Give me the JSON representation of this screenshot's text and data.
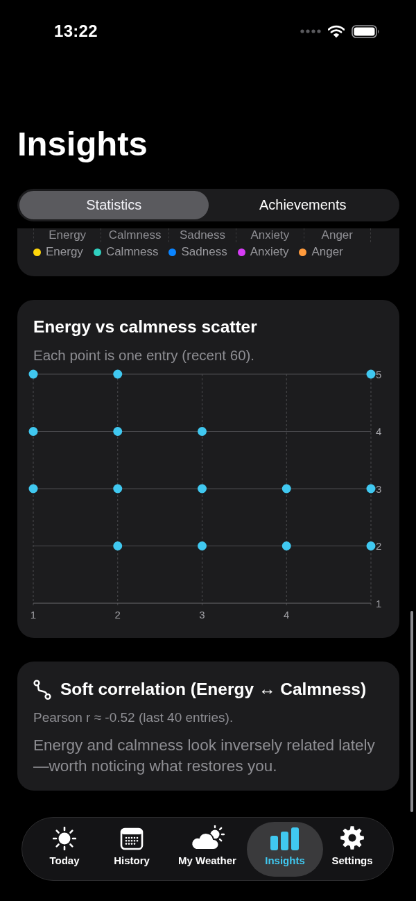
{
  "status_bar": {
    "time": "13:22"
  },
  "title": "Insights",
  "segments": [
    {
      "label": "Statistics",
      "selected": true
    },
    {
      "label": "Achievements",
      "selected": false
    }
  ],
  "emotion_card": {
    "axis_labels": [
      "Energy",
      "Calmness",
      "Sadness",
      "Anxiety",
      "Anger"
    ],
    "legend": [
      {
        "label": "Energy",
        "color": "#ffd60a"
      },
      {
        "label": "Calmness",
        "color": "#30d0c0"
      },
      {
        "label": "Sadness",
        "color": "#0a84ff"
      },
      {
        "label": "Anxiety",
        "color": "#d63cf5"
      },
      {
        "label": "Anger",
        "color": "#ff9a3c"
      }
    ]
  },
  "scatter_card": {
    "title": "Energy vs calmness scatter",
    "subtitle": "Each point is one entry (recent 60).",
    "chart_data": {
      "type": "scatter",
      "x": [
        1,
        2,
        5,
        1,
        2,
        3,
        1,
        2,
        3,
        4,
        5,
        2,
        3,
        4,
        5
      ],
      "series": [
        {
          "color": "#40c8f0",
          "values": [
            5,
            5,
            5,
            4,
            4,
            4,
            3,
            3,
            3,
            3,
            3,
            2,
            2,
            2,
            2
          ]
        }
      ],
      "xlim": [
        1,
        5
      ],
      "ylim": [
        1,
        5
      ],
      "xticks": [
        1,
        2,
        3,
        4
      ],
      "yticks": [
        1,
        2,
        3,
        4,
        5
      ],
      "grid": true
    }
  },
  "correlation_card": {
    "title": "Soft correlation (Energy ↔ Calmness)",
    "stat": "Pearson r ≈ -0.52 (last 40 entries).",
    "body": "Energy and calmness look inversely related lately—worth noticing what restores you."
  },
  "tab_bar": [
    {
      "kind": "today",
      "label": "Today",
      "selected": false
    },
    {
      "kind": "history",
      "label": "History",
      "selected": false
    },
    {
      "kind": "weather",
      "label": "My Weather",
      "selected": false
    },
    {
      "kind": "insights",
      "label": "Insights",
      "selected": true
    },
    {
      "kind": "settings",
      "label": "Settings",
      "selected": false
    }
  ]
}
